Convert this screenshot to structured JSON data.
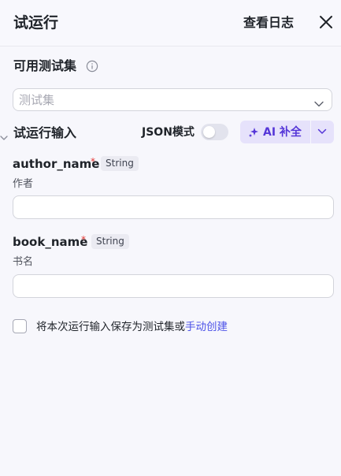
{
  "header": {
    "title": "试运行",
    "view_log": "查看日志",
    "close_icon": "close-icon"
  },
  "testset": {
    "label": "可用测试集",
    "info_icon": "info-icon",
    "placeholder": "测试集",
    "chevron_icon": "chevron-down-icon"
  },
  "run_input": {
    "label": "试运行输入",
    "json_mode_label": "JSON模式",
    "json_mode_on": false,
    "ai_fill_label": "AI 补全",
    "ai_icon": "sparkle-icon"
  },
  "fields": [
    {
      "name": "author_name",
      "required_mark": "*",
      "type": "String",
      "description": "作者",
      "value": ""
    },
    {
      "name": "book_name",
      "required_mark": "*",
      "type": "String",
      "description": "书名",
      "value": ""
    }
  ],
  "save_option": {
    "checked": false,
    "text": "将本次运行输入保存为测试集或",
    "link": "手动创建"
  },
  "colors": {
    "accent": "#4d53e8",
    "ai_accent": "#5536d8",
    "required": "#e53935",
    "background": "#f7f7fc"
  }
}
